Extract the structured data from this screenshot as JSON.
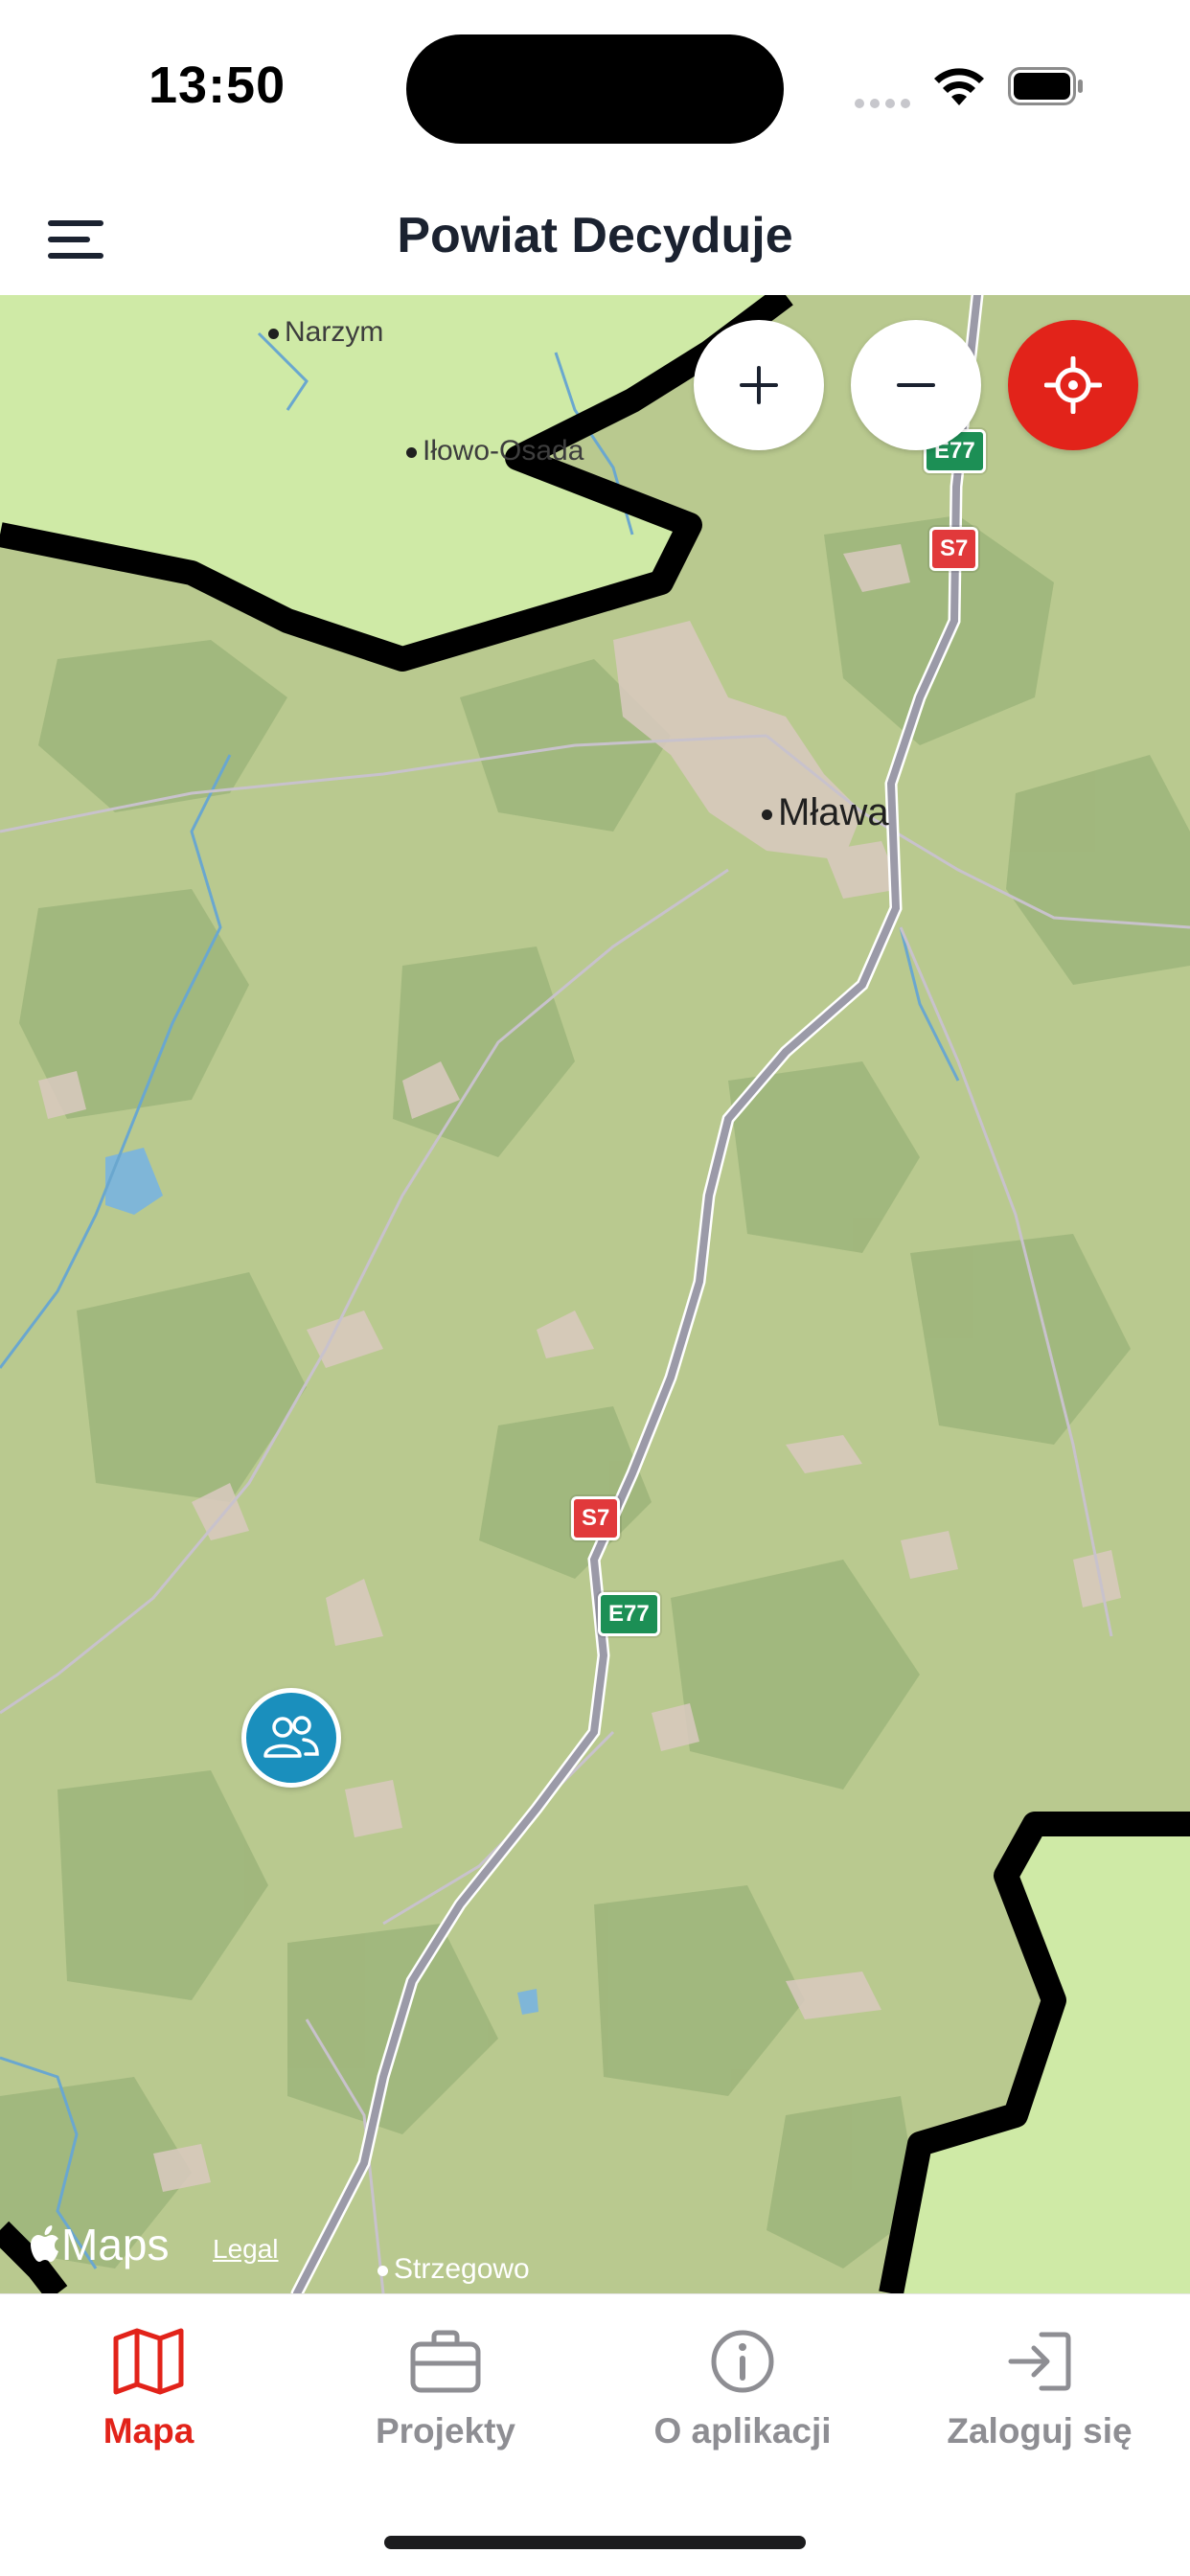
{
  "status_bar": {
    "time": "13:50"
  },
  "header": {
    "title": "Powiat Decyduje",
    "menu_icon": "hamburger-menu-icon"
  },
  "map": {
    "places": {
      "narzym": "Narzym",
      "ilowo": "Iłowo-Osada",
      "mlawa": "Mława",
      "strzegowo": "Strzegowo"
    },
    "road_shields": {
      "s7": "S7",
      "e77": "E77"
    },
    "controls": {
      "zoom_in_icon": "plus-icon",
      "zoom_out_icon": "minus-icon",
      "locate_icon": "locate-crosshair-icon"
    },
    "marker_icon": "people-group-icon",
    "attribution": {
      "brand": "Maps",
      "legal": "Legal"
    },
    "colors": {
      "land": "#b9c98f",
      "forest": "#9cb57a",
      "outside": "#cfeaa6",
      "boundary": "#000000",
      "road": "#9b9aa8",
      "accent": "#e2231a",
      "marker": "#1a8fbd"
    }
  },
  "tabbar": {
    "tabs": [
      {
        "label": "Mapa",
        "icon": "map-icon",
        "active": true
      },
      {
        "label": "Projekty",
        "icon": "briefcase-icon",
        "active": false
      },
      {
        "label": "O aplikacji",
        "icon": "info-icon",
        "active": false
      },
      {
        "label": "Zaloguj się",
        "icon": "login-icon",
        "active": false
      }
    ]
  }
}
